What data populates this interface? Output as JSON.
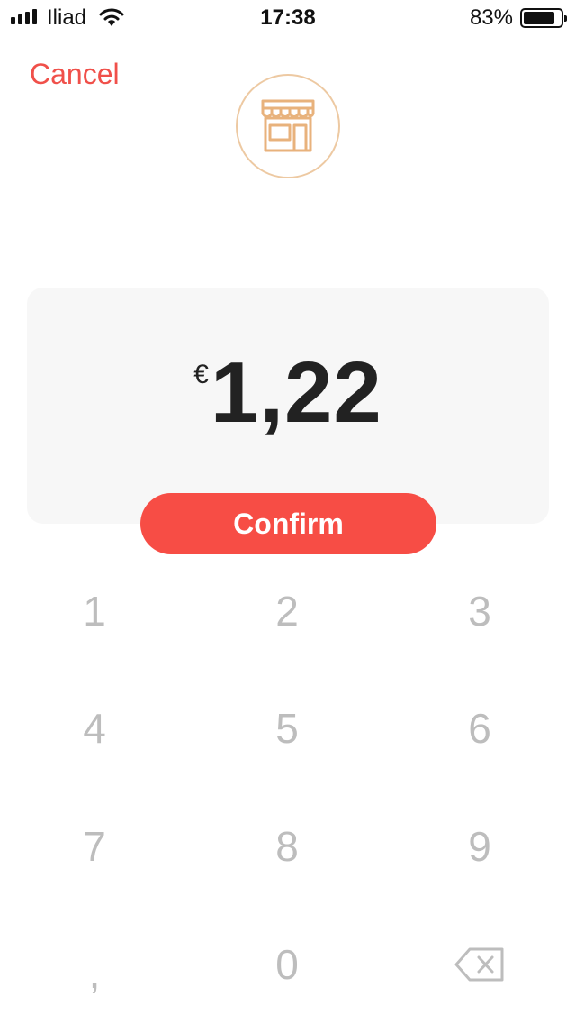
{
  "status_bar": {
    "carrier": "Iliad",
    "time": "17:38",
    "battery_percent": "83%",
    "battery_level": 0.83
  },
  "header": {
    "cancel_label": "Cancel",
    "merchant_icon": "storefront-icon"
  },
  "amount": {
    "currency": "€",
    "value": "1,22"
  },
  "confirm_label": "Confirm",
  "keypad": {
    "k1": "1",
    "k2": "2",
    "k3": "3",
    "k4": "4",
    "k5": "5",
    "k6": "6",
    "k7": "7",
    "k8": "8",
    "k9": "9",
    "comma": ",",
    "k0": "0",
    "backspace_icon": "backspace-icon"
  },
  "colors": {
    "accent": "#f74d45",
    "cancel_text": "#f0504a",
    "merchant_icon": "#e8b27c",
    "keypad_digits": "#bdbdbd"
  }
}
